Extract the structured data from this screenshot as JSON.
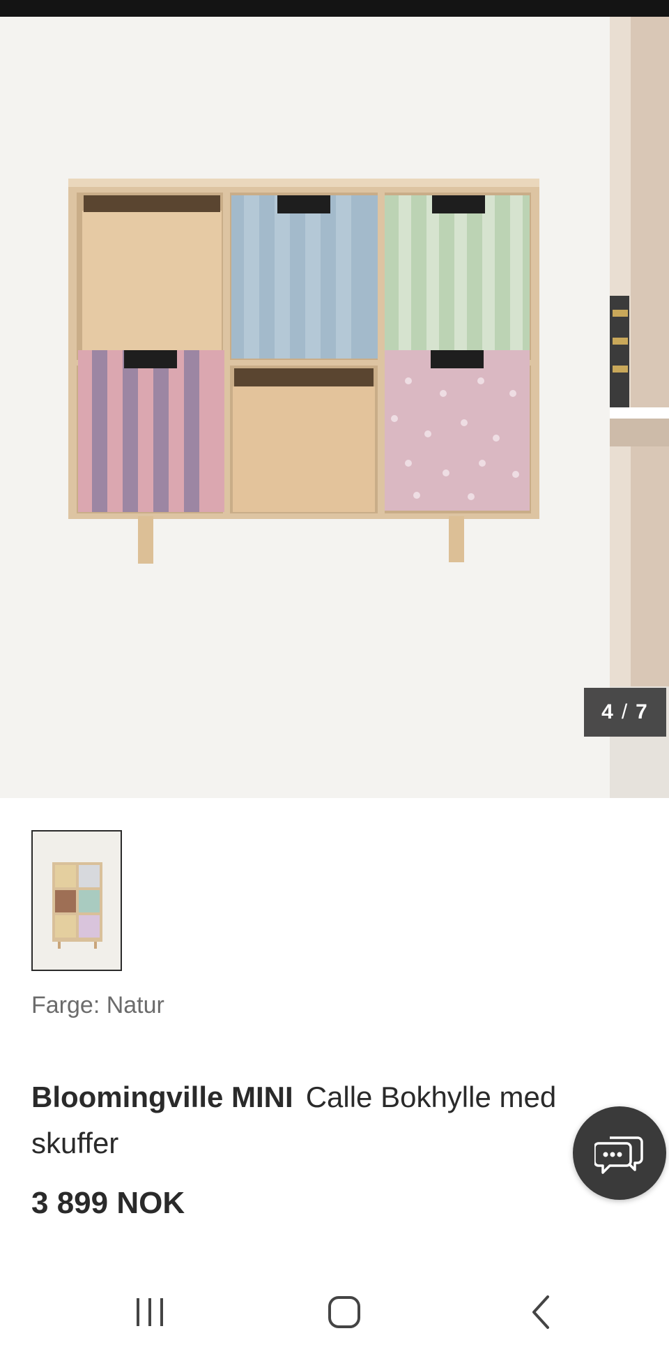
{
  "gallery": {
    "counter_current": "4",
    "counter_separator": "/",
    "counter_total": "7"
  },
  "product": {
    "color_label": "Farge: Natur",
    "brand": "Bloomingville MINI",
    "name": "Calle Bokhylle med skuffer",
    "price": "3 899 NOK"
  },
  "icons": {
    "chat": "chat-bubbles-icon",
    "recent_apps": "recent-apps-icon",
    "home": "home-icon",
    "back": "back-icon"
  }
}
